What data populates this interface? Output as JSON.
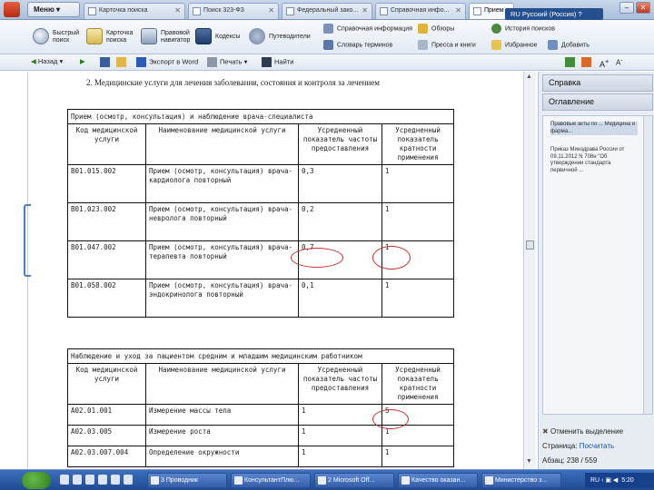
{
  "tabstrip": {
    "menu_label": "Меню",
    "tabs": [
      {
        "label": "Карточка поиска",
        "active": false
      },
      {
        "label": "Поиск 323-ФЗ",
        "active": false
      },
      {
        "label": "Федеральный зако...",
        "active": false
      },
      {
        "label": "Справочная инфо...",
        "active": false
      },
      {
        "label": "Прием",
        "active": true
      }
    ],
    "language": "RU Русский (Россия)"
  },
  "ribbon": {
    "quick_search": "Быстрый поиск",
    "search_card": "Карточка поиска",
    "legal_navigator": "Правовой навигатор",
    "codexes": "Кодексы",
    "guides": "Путеводители",
    "reference_info": "Справочная информация",
    "reviews": "Обзоры",
    "search_history": "История поисков",
    "term_dictionary": "Словарь терминов",
    "press_and_books": "Пресса и книги",
    "favorites": "Избранное",
    "add": "Добавить"
  },
  "toolbar": {
    "back": "Назад",
    "export_word": "Экспорт в Word",
    "print": "Печать",
    "find": "Найти"
  },
  "document": {
    "heading": "2. Медицинские услуги для лечения заболевания, состояния и контроля за лечением",
    "table1": {
      "title": "Прием (осмотр, консультация) и наблюдение врача-специалиста",
      "headers": [
        "Код медицинской услуги",
        "Наименование медицинской услуги",
        "Усредненный показатель частоты предоставления",
        "Усредненный показатель кратности применения"
      ],
      "rows": [
        {
          "code": "B01.015.002",
          "name": "Прием (осмотр, консультация) врача-кардиолога повторный",
          "freq": "0,3",
          "mult": "1"
        },
        {
          "code": "B01.023.002",
          "name": "Прием (осмотр, консультация) врача-невролога повторный",
          "freq": "0,2",
          "mult": "1"
        },
        {
          "code": "B01.047.002",
          "name": "Прием (осмотр, консультация) врача-терапевта повторный",
          "freq": "0,7",
          "mult": "1"
        },
        {
          "code": "B01.058.002",
          "name": "Прием (осмотр, консультация) врача-эндокринолога повторный",
          "freq": "0,1",
          "mult": "1"
        }
      ]
    },
    "table2": {
      "title": "Наблюдение и уход за пациентом средним и младшим медицинским работником",
      "headers": [
        "Код медицинской услуги",
        "Наименование медицинской услуги",
        "Усредненный показатель частоты предоставления",
        "Усредненный показатель кратности применения"
      ],
      "rows": [
        {
          "code": "A02.01.001",
          "name": "Измерение массы тела",
          "freq": "1",
          "mult": "5"
        },
        {
          "code": "A02.03.005",
          "name": "Измерение роста",
          "freq": "1",
          "mult": "1"
        },
        {
          "code": "A02.03.007.004",
          "name": "Определение окружности",
          "freq": "1",
          "mult": "1"
        }
      ]
    }
  },
  "side": {
    "help": "Справка",
    "contents": "Оглавление",
    "item1": "Правовые акты по ... Медицина и фарма...",
    "item2": "Приказ Минздрава России от 09.11.2012 N 708н \"Об утверждении стандарта первичной ...",
    "clear_selection": "Отменить выделение",
    "page_label": "Страница:",
    "page_action": "Посчитать",
    "paragraph_label": "Абзац:",
    "paragraph_value": "238 / 559"
  },
  "taskbar": {
    "tasks": [
      "3 Проводник",
      "КонсультантПлю...",
      "2 Microsoft Off...",
      "Качество оказан...",
      "Министерство з..."
    ],
    "lang": "RU",
    "time": "5:20"
  }
}
